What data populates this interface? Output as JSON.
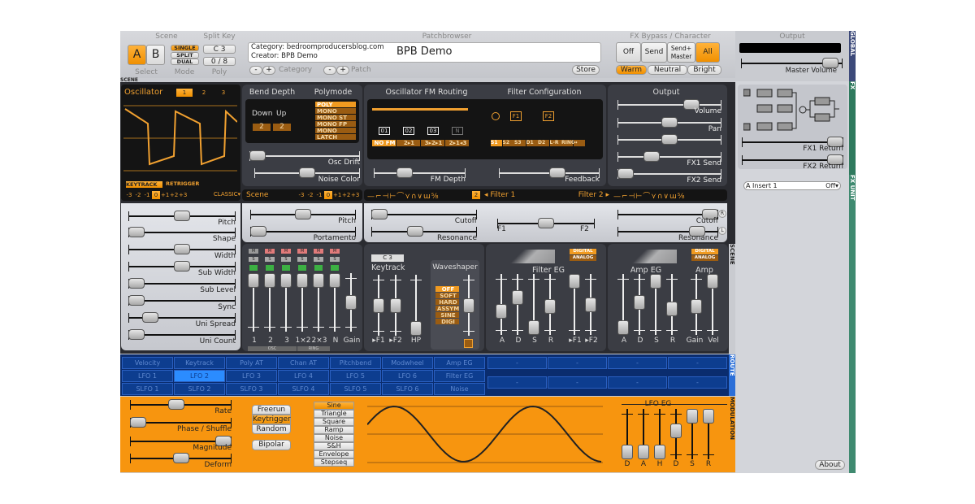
{
  "top": {
    "scene_label": "Scene",
    "split_key_label": "Split Key",
    "select_label": "Select",
    "mode_label": "Mode",
    "poly_label": "Poly",
    "scene_a": "A",
    "scene_b": "B",
    "modes": [
      "SINGLE",
      "SPLIT",
      "DUAL"
    ],
    "split_key": "C 3",
    "poly": "0 / 8",
    "patchbrowser_label": "Patchbrowser",
    "category_line": "Category: bedroomproducersblog.com",
    "creator_line": "Creator: BPB Demo",
    "patch_name": "BPB Demo",
    "category_label": "Category",
    "patch_label": "Patch",
    "minus": "-",
    "plus": "+",
    "store": "Store",
    "fx_label": "FX Bypass / Character",
    "fx_buttons": [
      "Off",
      "Send",
      "Send+\nMaster",
      "All"
    ],
    "fx_selected": "All",
    "character": [
      "Warm",
      "Neutral",
      "Bright"
    ],
    "character_selected": "Warm",
    "output_label": "Output",
    "master_volume_label": "Master Volume",
    "master_volume": 0.95
  },
  "side_tabs": {
    "global": "GLOBAL",
    "fx": "FX",
    "fx_unit": "FX UNIT",
    "scene": "SCENE",
    "route": "ROUTE",
    "modulation": "MODULATION"
  },
  "scene_tag": "SCENE",
  "osc": {
    "title": "Oscillator",
    "tabs": [
      "1",
      "2",
      "3"
    ],
    "selected": "1",
    "keytrack": "KEYTRACK",
    "retrigger": "RETRIGGER",
    "octaves": [
      "-3",
      "-2",
      "-1",
      "0",
      "+1",
      "+2",
      "+3"
    ],
    "octave_selected": "0",
    "type": "CLASSIC▾",
    "params": [
      {
        "label": "Pitch",
        "value": 0.5
      },
      {
        "label": "Shape",
        "value": 0
      },
      {
        "label": "Width",
        "value": 0.5
      },
      {
        "label": "Sub Width",
        "value": 0.5
      },
      {
        "label": "Sub Level",
        "value": 0
      },
      {
        "label": "Sync",
        "value": 0
      },
      {
        "label": "Uni Spread",
        "value": 0.15
      },
      {
        "label": "Uni Count",
        "value": 0
      }
    ]
  },
  "bend": {
    "title": "Bend Depth",
    "down_label": "Down",
    "up_label": "Up",
    "down": "2",
    "up": "2"
  },
  "polymode": {
    "title": "Polymode",
    "options": [
      "POLY",
      "MONO",
      "MONO ST",
      "MONO FP",
      "MONO ST+FP",
      "LATCH"
    ],
    "selected": "POLY"
  },
  "drift": {
    "osc_drift": {
      "label": "Osc Drift",
      "value": 0
    },
    "noise_color": {
      "label": "Noise Color",
      "value": 0.5
    }
  },
  "fm": {
    "title": "Oscillator FM Routing",
    "boxes": [
      "01",
      "02",
      "03",
      "N"
    ],
    "options": [
      "NO FM",
      "2▸1",
      "3▸2▸1",
      "2▸1◂3"
    ],
    "selected": "NO FM",
    "depth": {
      "label": "FM Depth",
      "value": 0.3
    }
  },
  "filtercfg": {
    "title": "Filter Configuration",
    "blocks": [
      "F1",
      "F2"
    ],
    "options": [
      "S1",
      "S2",
      "S3",
      "D1",
      "D2",
      "L-R",
      "RING",
      "↔"
    ],
    "selected": "S1",
    "feedback": {
      "label": "Feedback",
      "value": 0.6
    }
  },
  "output": {
    "title": "Output",
    "sliders": [
      {
        "label": "Volume",
        "value": 0.75
      },
      {
        "label": "Pan",
        "value": 0.5
      },
      {
        "label": "",
        "value": 0.5
      },
      {
        "label": "FX1 Send",
        "value": 0.3
      },
      {
        "label": "FX2 Send",
        "value": 0
      }
    ]
  },
  "scene_bar": {
    "label": "Scene",
    "octaves": [
      "-3",
      "-2",
      "-1",
      "0",
      "+1",
      "+2",
      "+3"
    ],
    "selected": "0"
  },
  "filter_bar": {
    "filter1": "◂ Filter 1",
    "filter2": "Filter 2 ▸",
    "num": "2",
    "types": "—⌐⊣⊢⌒⋎∩∨ɯ⅝"
  },
  "scene_params": [
    {
      "label": "Pitch",
      "value": 0.5
    },
    {
      "label": "Portamento",
      "value": 0
    }
  ],
  "filter1": [
    {
      "label": "Cutoff",
      "value": 0
    },
    {
      "label": "Resonance",
      "value": 0.4
    }
  ],
  "balance": {
    "f1": "F1",
    "f2": "F2",
    "value": 0.5
  },
  "filter2": [
    {
      "label": "Cutoff",
      "value": 1
    },
    {
      "label": "Resonance",
      "value": 0.85
    }
  ],
  "filter2_buttons": [
    "R",
    "L"
  ],
  "mixer": {
    "labels": [
      "1",
      "2",
      "3",
      "1×2",
      "2×3",
      "N",
      "Gain"
    ],
    "values": [
      1,
      1,
      1,
      1,
      1,
      1,
      0.5
    ],
    "m": "M",
    "s": "S",
    "osc_group": "OSC",
    "ring_group": "RING"
  },
  "keytrack": {
    "key": "C 3",
    "title": "Keytrack",
    "labels": [
      "▸F1",
      "▸F2",
      "HP"
    ],
    "values": [
      0.5,
      0.5,
      0
    ]
  },
  "waveshaper": {
    "title": "Waveshaper",
    "options": [
      "OFF",
      "SOFT",
      "HARD",
      "ASSYM",
      "SINE",
      "DIGI"
    ],
    "selected": "OFF",
    "value": 0.5
  },
  "filter_eg": {
    "title": "Filter EG",
    "modes": [
      "DIGITAL",
      "ANALOG"
    ],
    "labels": [
      "A",
      "D",
      "S",
      "R",
      "▸F1",
      "▸F2"
    ],
    "values": [
      0.35,
      0.65,
      0,
      0.45,
      1,
      0.5
    ]
  },
  "amp_eg": {
    "title": "Amp EG",
    "amp_title": "Amp",
    "modes": [
      "DIGITAL",
      "ANALOG"
    ],
    "labels": [
      "A",
      "D",
      "S",
      "R",
      "Gain",
      "Vel"
    ],
    "values": [
      0,
      0.55,
      1,
      0.4,
      0.45,
      1
    ]
  },
  "route": {
    "rows": [
      [
        "Velocity",
        "Keytrack",
        "Poly AT",
        "Chan AT",
        "Pitchbend",
        "Modwheel",
        "Amp EG"
      ],
      [
        "LFO 1",
        "LFO 2",
        "LFO 3",
        "LFO 4",
        "LFO 5",
        "LFO 6",
        "Filter EG"
      ],
      [
        "SLFO 1",
        "SLFO 2",
        "SLFO 3",
        "SLFO 4",
        "SLFO 5",
        "SLFO 6",
        "Noise"
      ]
    ],
    "selected": "LFO 2",
    "empty": "-"
  },
  "lfo": {
    "sliders": [
      {
        "label": "Rate",
        "value": 0.45
      },
      {
        "label": "Phase / Shuffle",
        "value": 0
      },
      {
        "label": "Magnitude",
        "value": 1
      },
      {
        "label": "Deform",
        "value": 0.5
      }
    ],
    "trigger": [
      "Freerun",
      "Keytrigger",
      "Random"
    ],
    "trigger_selected": "Keytrigger",
    "bipolar": "Bipolar",
    "shapes": [
      "Sine",
      "Triangle",
      "Square",
      "Ramp",
      "Noise",
      "S&H",
      "Envelope",
      "Stepseq"
    ],
    "shape_selected": "Sine",
    "eg_title": "LFO EG",
    "eg_labels": [
      "D",
      "A",
      "H",
      "D",
      "S",
      "R"
    ],
    "eg_values": [
      0,
      0,
      0,
      0.6,
      1,
      1
    ]
  },
  "fx": {
    "returns": [
      {
        "label": "FX1 Return",
        "value": 1
      },
      {
        "label": "FX2 Return",
        "value": 1
      }
    ],
    "slot": "A Insert 1",
    "slot_state": "Off▾",
    "about": "About"
  },
  "colors": {
    "accent": "#f09a20",
    "route": "#0d3d8f",
    "panel": "#3b3d44"
  }
}
